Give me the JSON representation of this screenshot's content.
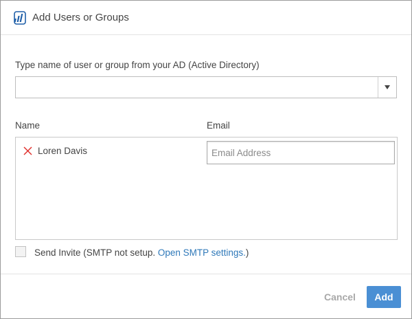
{
  "dialog": {
    "title": "Add Users or Groups",
    "icon": "app-logo-icon"
  },
  "ad_search": {
    "label": "Type name of user or group from your AD (Active Directory)",
    "value": ""
  },
  "users_table": {
    "columns": [
      "Name",
      "Email"
    ],
    "rows": [
      {
        "name": "Loren Davis",
        "email_value": "",
        "email_placeholder": "Email Address"
      }
    ]
  },
  "invite": {
    "checked": false,
    "text": "Send Invite (SMTP not setup. ",
    "link_text": "Open SMTP settings.",
    "suffix": ")"
  },
  "footer": {
    "cancel_label": "Cancel",
    "add_label": "Add"
  },
  "colors": {
    "accent": "#4a8fd4",
    "link": "#2e78b9",
    "remove": "#e0322f"
  }
}
